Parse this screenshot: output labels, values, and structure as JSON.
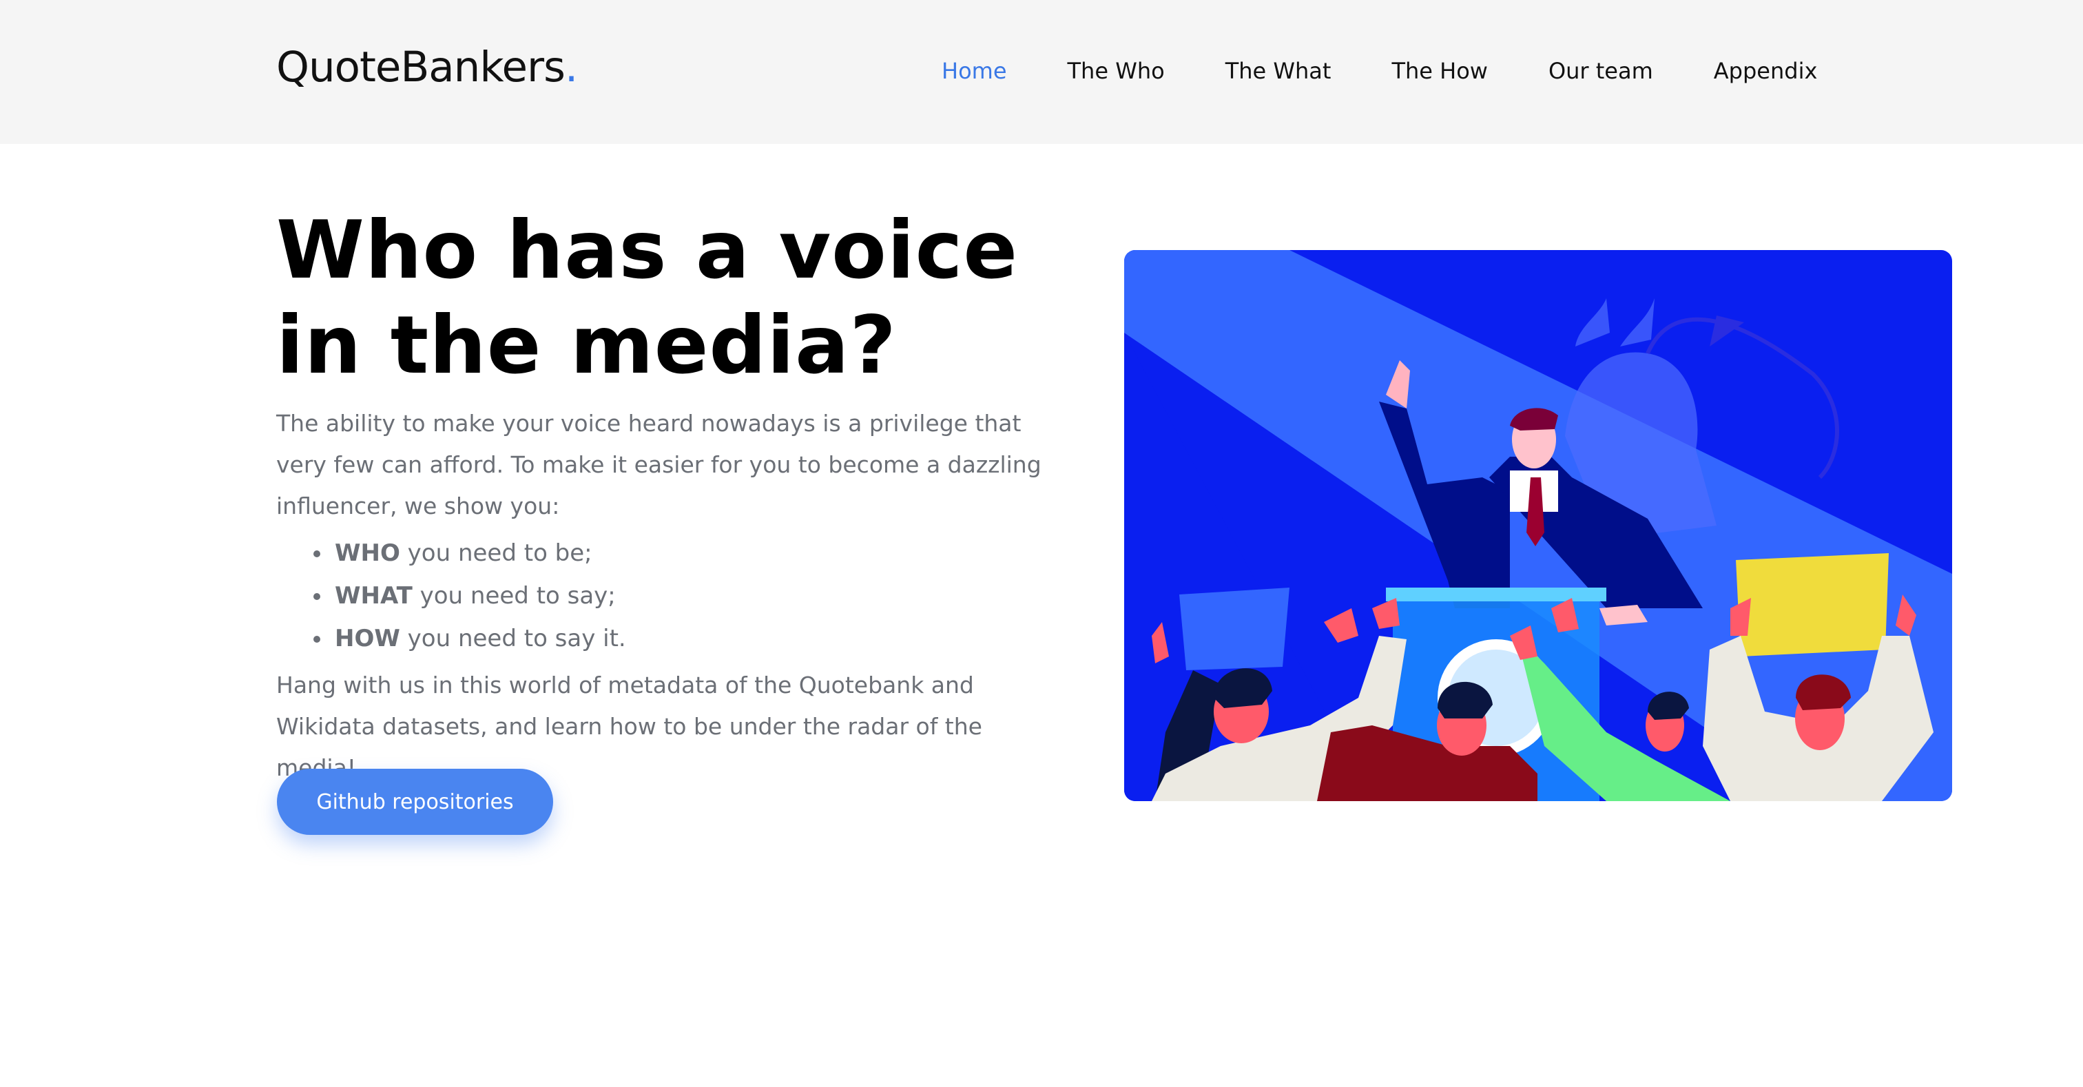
{
  "brand": {
    "name": "QuoteBankers",
    "dot": "."
  },
  "nav": [
    {
      "label": "Home",
      "active": true
    },
    {
      "label": "The Who"
    },
    {
      "label": "The What"
    },
    {
      "label": "The How"
    },
    {
      "label": "Our team"
    },
    {
      "label": "Appendix"
    }
  ],
  "hero": {
    "title": "Who has a voice in the media?",
    "intro": "The ability to make your voice heard nowadays is a privilege that very few can afford. To make it easier for you to become a dazzling influencer, we show you:",
    "bullets": [
      {
        "bold": "WHO",
        "rest": " you need to be;"
      },
      {
        "bold": "WHAT",
        "rest": " you need to say;"
      },
      {
        "bold": "HOW",
        "rest": " you need to say it."
      }
    ],
    "outro": "Hang with us in this world of metadata of the Quotebank and Wikidata datasets, and learn how to be under the radar of the media!",
    "button_label": "Github repositories"
  },
  "colors": {
    "accent": "#3a78e6",
    "button": "#4a85f0",
    "illustration_bg": "#0a1ff0",
    "illustration_beam": "#3366ff"
  }
}
